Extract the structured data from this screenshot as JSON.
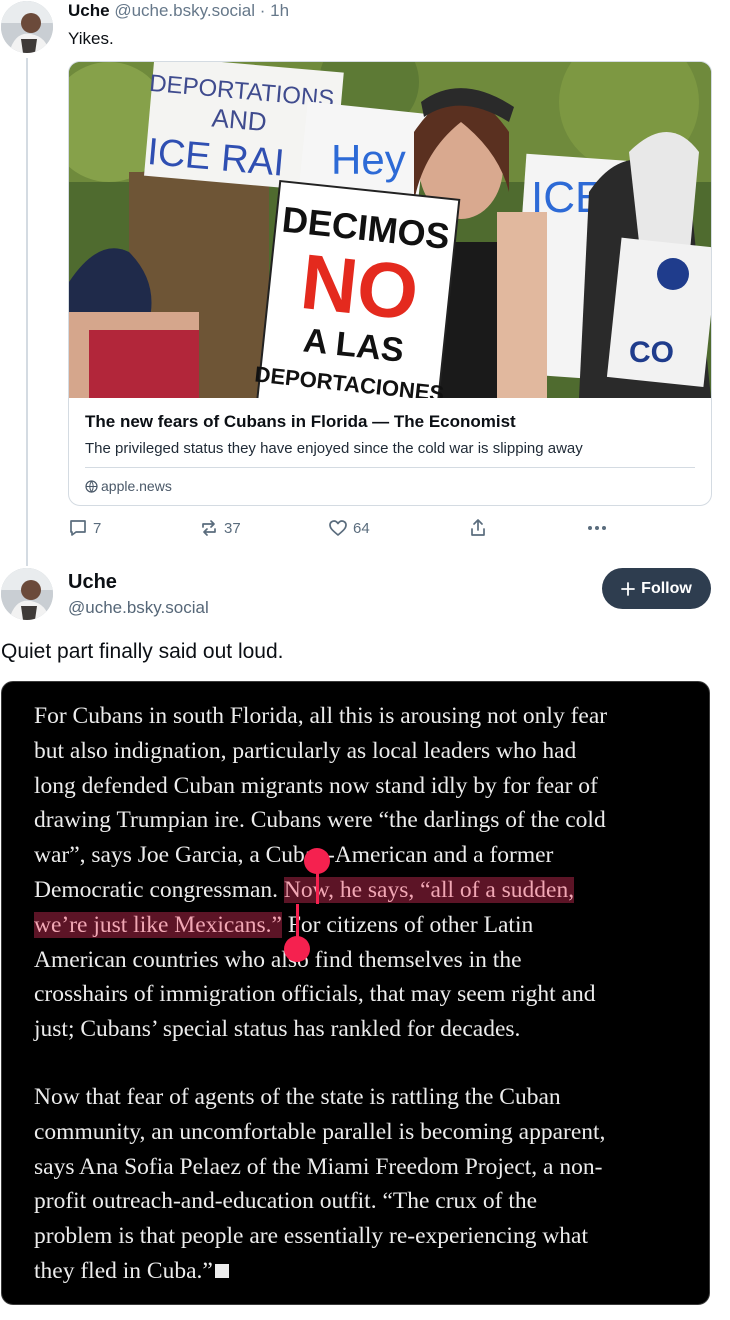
{
  "post1": {
    "name": "Uche",
    "handle": "@uche.bsky.social",
    "time": "· 1h",
    "text": "Yikes.",
    "card": {
      "title": "The new fears of Cubans in Florida — The Economist",
      "description": "The privileged status they have enjoyed since the cold war is slipping away",
      "source": "apple.news",
      "image_signs": {
        "sign1": [
          "DEPORTATIONS",
          "AND",
          "ICE RAI"
        ],
        "sign2": "Hey",
        "sign3": [
          "DECIMOS",
          "NO",
          "A LAS",
          "DEPORTACIONES"
        ],
        "sign4": "ICE:",
        "sign5": "CO"
      }
    },
    "actions": {
      "replies": "7",
      "reposts": "37",
      "likes": "64"
    }
  },
  "post2": {
    "name": "Uche",
    "handle": "@uche.bsky.social",
    "follow_label": "Follow",
    "text": "Quiet part finally said out loud.",
    "quote": {
      "p1": [
        "For Cubans in south Florida, all this is arousing not only fear",
        "but also indignation, particularly as local leaders who had",
        "long defended Cuban migrants now stand idly by for fear of",
        "drawing Trumpian ire. Cubans were “the darlings of the cold",
        "war”, says Joe Garcia, a Cuban-American and a former"
      ],
      "p1_line6_plain": "Democratic congressman. ",
      "p1_line6_hl": "Now, he says, “all of a sudden,",
      "p1_line7_hl": "we’re just like Mexicans.”",
      "p1_line7_plain": " For citizens of other Latin",
      "p1_rest": [
        "American countries who also find themselves in the",
        "crosshairs of immigration officials, that may seem right and",
        "just; Cubans’ special status has rankled for decades."
      ],
      "p2": [
        "Now that fear of agents of the state is rattling the Cuban",
        "community, an uncomfortable parallel is becoming apparent,",
        "says Ana Sofia Pelaez of the Miami Freedom Project, a non-",
        "profit outreach-and-education outfit. “The crux of the",
        "problem is that people are essentially re-experiencing what"
      ],
      "p2_last": "they fled in Cuba.”"
    }
  },
  "colors": {
    "follow_bg": "#2e3d4f",
    "highlight_bg": "#5c1426",
    "highlight_text": "#f1a7b4",
    "selection_handle": "#f5214f"
  }
}
